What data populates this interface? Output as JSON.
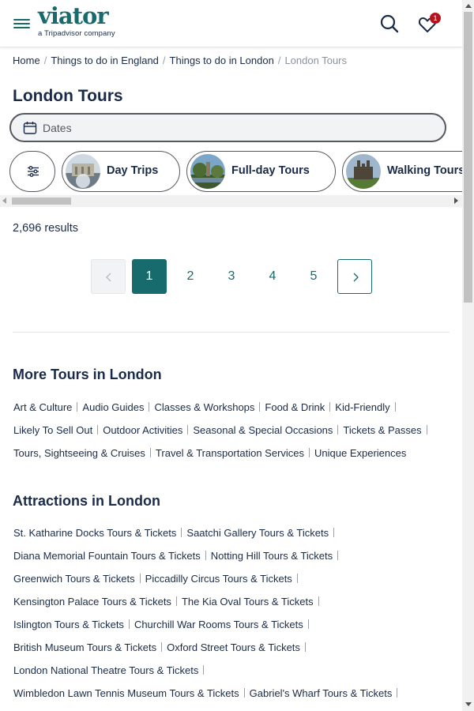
{
  "header": {
    "logo_text": "viator",
    "logo_sub": "a Tripadvisor company",
    "wishlist_count": "1"
  },
  "breadcrumb": [
    {
      "label": "Home"
    },
    {
      "label": "Things to do in England"
    },
    {
      "label": "Things to do in London"
    },
    {
      "label": "London Tours"
    }
  ],
  "page_title": "London Tours",
  "dates": {
    "placeholder": "Dates"
  },
  "chips": [
    {
      "label": "Day Trips"
    },
    {
      "label": "Full-day Tours"
    },
    {
      "label": "Walking Tours"
    }
  ],
  "results_text": "2,696 results",
  "pagination": {
    "pages": [
      "1",
      "2",
      "3",
      "4",
      "5"
    ],
    "current": "1"
  },
  "more_tours": {
    "title": "More Tours in London",
    "rows": [
      [
        "Art & Culture",
        "Audio Guides",
        "Classes & Workshops",
        "Food & Drink",
        "Kid-Friendly"
      ],
      [
        "Likely To Sell Out",
        "Outdoor Activities",
        "Seasonal & Special Occasions",
        "Tickets & Passes"
      ],
      [
        "Tours, Sightseeing & Cruises",
        "Travel & Transportation Services",
        "Unique Experiences"
      ]
    ]
  },
  "attractions": {
    "title": "Attractions in London",
    "rows": [
      [
        "St. Katharine Docks Tours & Tickets",
        "Saatchi Gallery Tours & Tickets"
      ],
      [
        "Diana Memorial Fountain Tours & Tickets",
        "Notting Hill Tours & Tickets"
      ],
      [
        "Greenwich Tours & Tickets",
        "Piccadilly Circus Tours & Tickets"
      ],
      [
        "Kensington Palace Tours & Tickets",
        "The Kia Oval Tours & Tickets"
      ],
      [
        "Islington Tours & Tickets",
        "Churchill War Rooms Tours & Tickets"
      ],
      [
        "British Museum Tours & Tickets",
        "Oxford Street Tours & Tickets"
      ],
      [
        "London National Theatre Tours & Tickets"
      ],
      [
        "Wimbledon Lawn Tennis Museum Tours & Tickets",
        "Gabriel's Wharf Tours & Tickets"
      ]
    ]
  },
  "colors": {
    "brand": "#186b6d",
    "text": "#1a2b49",
    "badge": "#b4131d"
  }
}
